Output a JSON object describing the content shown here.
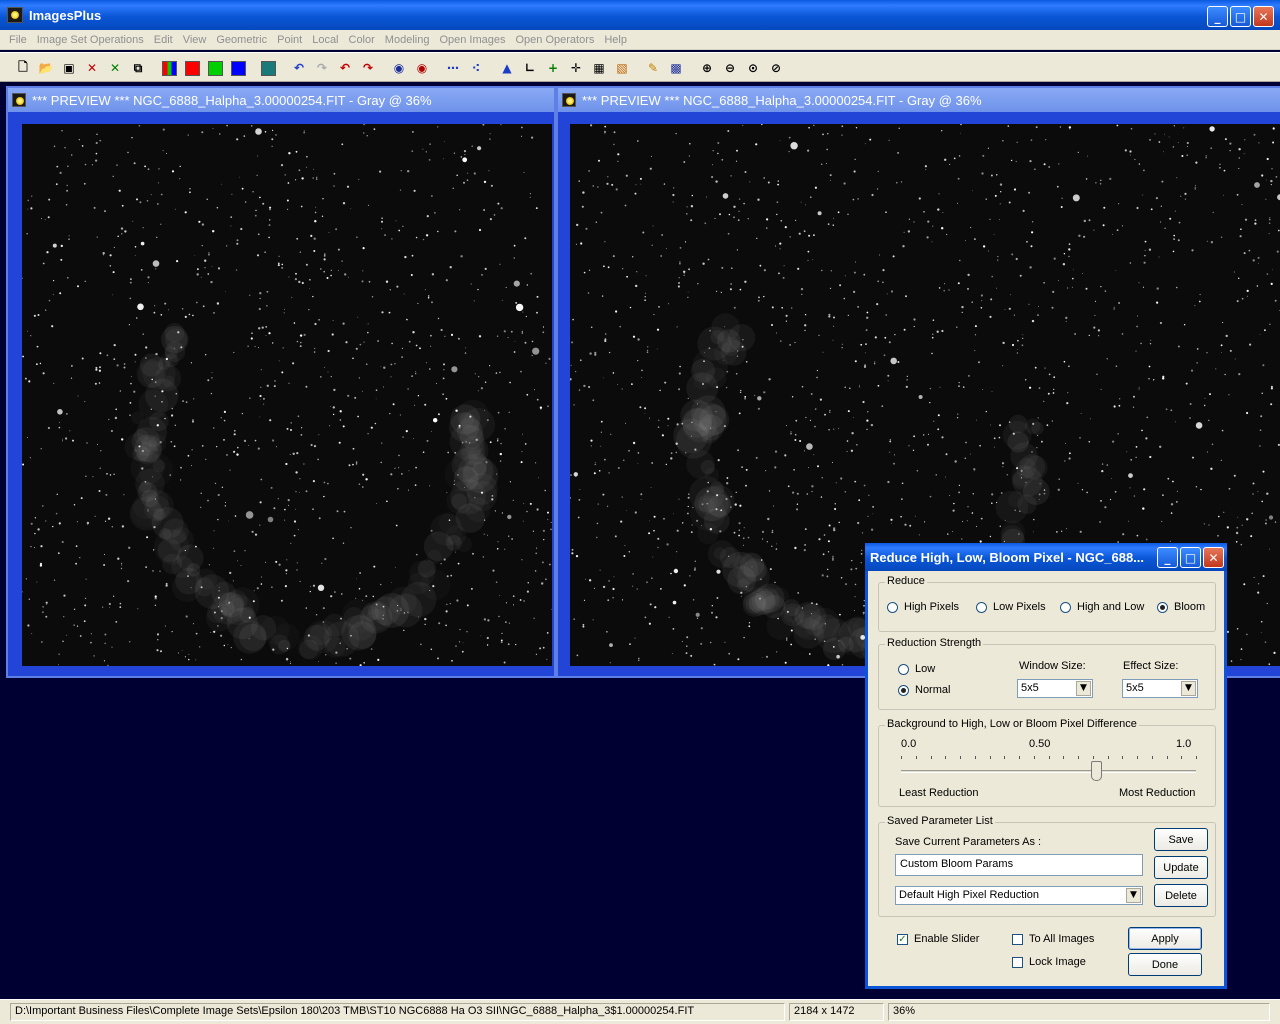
{
  "app": {
    "title": "ImagesPlus"
  },
  "menu": [
    "File",
    "Image Set Operations",
    "Edit",
    "View",
    "Geometric",
    "Point",
    "Local",
    "Color",
    "Modeling",
    "Open Images",
    "Open Operators",
    "Help"
  ],
  "toolbar": {
    "buttons": [
      "new-file",
      "open-folder",
      "save",
      "close-image",
      "close-all",
      "window",
      "rgb",
      "red-channel",
      "green-channel",
      "blue-channel",
      "grid",
      "undo",
      "redo",
      "undo-all",
      "redo-all",
      "circle-select",
      "ellipse-select",
      "dots",
      "points",
      "histogram",
      "curves",
      "add",
      "crosshair",
      "calculator",
      "paint",
      "pencil",
      "matrix",
      "zoom-in",
      "zoom-out",
      "zoom-fit",
      "zoom-actual"
    ],
    "colors": {
      "red": "#ff0000",
      "green": "#00d000",
      "blue": "#0000ff"
    }
  },
  "windows": [
    {
      "title": "*** PREVIEW *** NGC_6888_Halpha_3.00000254.FIT - Gray @ 36%"
    },
    {
      "title": "*** PREVIEW *** NGC_6888_Halpha_3.00000254.FIT - Gray @ 36%"
    }
  ],
  "dialog": {
    "title": "Reduce High, Low, Bloom Pixel - NGC_688...",
    "reduce": {
      "legend": "Reduce",
      "options": [
        "High Pixels",
        "Low Pixels",
        "High and Low",
        "Bloom"
      ],
      "selected": "Bloom"
    },
    "strength": {
      "legend": "Reduction Strength",
      "options": [
        "Low",
        "Normal"
      ],
      "selected": "Normal",
      "window_size_label": "Window Size:",
      "window_size": "5x5",
      "effect_size_label": "Effect Size:",
      "effect_size": "5x5"
    },
    "difference": {
      "legend": "Background to High, Low or Bloom Pixel Difference",
      "tick_labels": [
        "0.0",
        "0.50",
        "1.0"
      ],
      "min_label": "Least Reduction",
      "max_label": "Most Reduction",
      "value": 0.66
    },
    "saved": {
      "legend": "Saved Parameter List",
      "save_as_label": "Save Current Parameters As :",
      "save_as_value": "Custom Bloom Params",
      "list_selected": "Default High Pixel Reduction",
      "save_button": "Save",
      "update_button": "Update",
      "delete_button": "Delete"
    },
    "enable_slider": {
      "label": "Enable Slider",
      "checked": true
    },
    "to_all_images": {
      "label": "To All Images",
      "checked": false
    },
    "lock_image": {
      "label": "Lock Image",
      "checked": false
    },
    "apply_button": "Apply",
    "done_button": "Done"
  },
  "status": {
    "path": "D:\\Important Business Files\\Complete Image Sets\\Epsilon 180\\203 TMB\\ST10 NGC6888 Ha O3 SII\\NGC_6888_Halpha_3$1.00000254.FIT",
    "dimensions": "2184 x 1472",
    "zoom": "36%"
  }
}
